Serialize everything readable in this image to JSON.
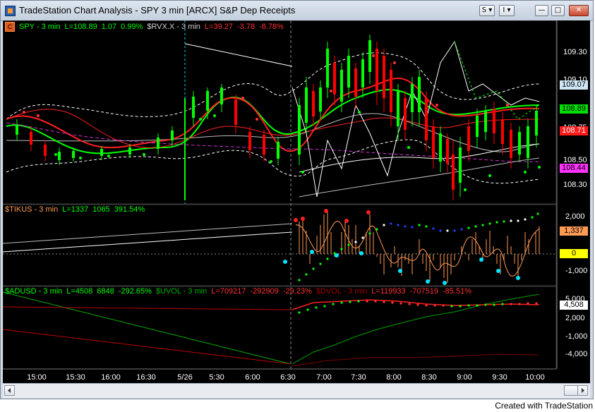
{
  "window": {
    "title": "TradeStation Chart Analysis - SPY 3 min [ARCX] S&P Dep Receipts",
    "buttons": {
      "style": "S",
      "menu": "I",
      "minimize": "—",
      "maximize": "□",
      "close": "✕"
    }
  },
  "legend_price": {
    "badge": "C",
    "symbol": "SPY - 3 min",
    "last": "L=108.89",
    "change": "1.07",
    "pct": "0.99%",
    "symbol2": "$RVX.X - 3 min",
    "last2": "L=39.27",
    "change2": "-3.78",
    "pct2": "-8.78%"
  },
  "legend_tikus": {
    "symbol": "$TIKUS - 3 min",
    "last": "L=1337",
    "change": "1065",
    "pct": "391.54%"
  },
  "legend_adusd": {
    "s1": "$ADUSD - 3 min",
    "l1": "L=4508",
    "c1": "6848",
    "p1": "-292.65%",
    "s2": "$UVOL - 3 min",
    "l2": "L=709217",
    "c2": "-292909",
    "p2": "-29.23%",
    "s3": "$DVOL - 3 min",
    "l3": "L=119933",
    "c3": "-707519",
    "p3": "-85.51%"
  },
  "price_axis": [
    "109.30",
    "109.10",
    "108.75",
    "108.50",
    "108.30"
  ],
  "price_boxes": [
    {
      "label": "109.07",
      "bg": "#cfe6f5",
      "fg": "#000000"
    },
    {
      "label": "108.89",
      "bg": "#00e000",
      "fg": "#000000"
    },
    {
      "label": "108.71",
      "bg": "#ff1a1a",
      "fg": "#ffffff"
    },
    {
      "label": "108.44",
      "bg": "#ff33ff",
      "fg": "#000000"
    }
  ],
  "tick_axis": [
    "2,000",
    "1,000",
    "-1,000"
  ],
  "tick_boxes": [
    {
      "label": "1,337",
      "bg": "#ff9a55",
      "fg": "#000000"
    },
    {
      "label": "0",
      "bg": "#ffff00",
      "fg": "#000000"
    }
  ],
  "ad_axis": [
    "5,000",
    "2,000",
    "-1,000",
    "-4,000"
  ],
  "ad_box": {
    "label": "4,508",
    "bg": "#ffffff",
    "fg": "#000000"
  },
  "time_axis": [
    "15:00",
    "15:30",
    "16:00",
    "16:30",
    "5/26",
    "5:30",
    "6:00",
    "6:30",
    "7:00",
    "7:30",
    "8:00",
    "8:30",
    "9:00",
    "9:30",
    "10:00"
  ],
  "footer": "Created with TradeStation",
  "colors": {
    "price_up": "#00ff00",
    "price_down": "#ff0000",
    "legend_green": "#00ff00",
    "legend_red": "#ff3030",
    "legend_gray": "#d0d0d0",
    "tick_bars": "#ff9a55"
  }
}
